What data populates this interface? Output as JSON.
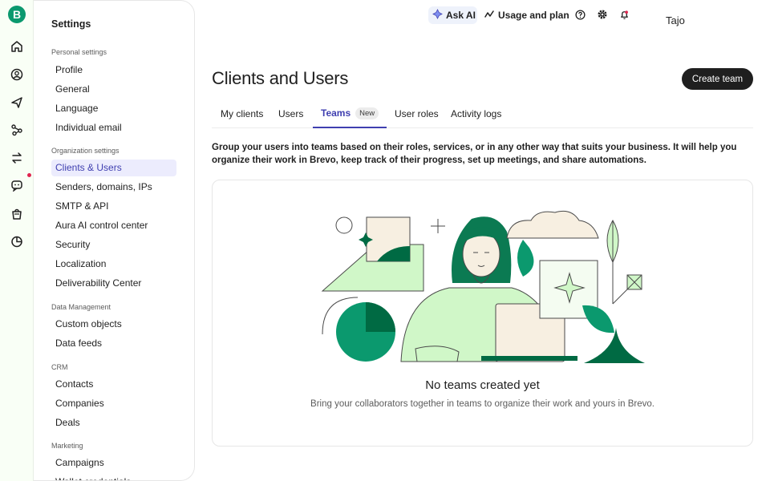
{
  "rail": {
    "logo": "B",
    "icons": [
      "home-icon",
      "contacts-icon",
      "campaigns-icon",
      "automations-icon",
      "transfer-icon",
      "conversations-icon",
      "sales-icon",
      "reports-icon"
    ]
  },
  "sidebar": {
    "title": "Settings",
    "sections": {
      "personal": "Personal settings",
      "organization": "Organization settings",
      "data_management": "Data Management",
      "crm": "CRM",
      "marketing": "Marketing"
    },
    "items": {
      "profile": "Profile",
      "general": "General",
      "language": "Language",
      "individual_email": "Individual email",
      "clients_users": "Clients & Users",
      "senders": "Senders, domains, IPs",
      "smtp": "SMTP & API",
      "aura": "Aura AI control center",
      "security": "Security",
      "localization": "Localization",
      "deliverability": "Deliverability Center",
      "custom_objects": "Custom objects",
      "data_feeds": "Data feeds",
      "contacts": "Contacts",
      "companies": "Companies",
      "deals": "Deals",
      "campaigns": "Campaigns",
      "wallet": "Wallet credentials"
    }
  },
  "topbar": {
    "ask_ai": "Ask AI",
    "usage": "Usage and plan",
    "user_name": "Tajo"
  },
  "main": {
    "title": "Clients and Users",
    "create_button": "Create team",
    "tabs": {
      "my_clients": "My clients",
      "users": "Users",
      "teams": "Teams",
      "teams_badge": "New",
      "user_roles": "User roles",
      "activity_logs": "Activity logs"
    },
    "description": "Group your users into teams based on their roles, services, or in any other way that suits your business. It will help you organize their work in Brevo, keep track of their progress, set up meetings, and share automations.",
    "empty_title": "No teams created yet",
    "empty_subtitle": "Bring your collaborators together in teams to organize their work and yours in Brevo."
  },
  "colors": {
    "brand_green": "#0b996e",
    "dark_green": "#006a43",
    "light_green": "#d0f7c8",
    "cream": "#f7efe1",
    "active_blue": "#3f3fb0",
    "active_bg": "#ececfd"
  }
}
